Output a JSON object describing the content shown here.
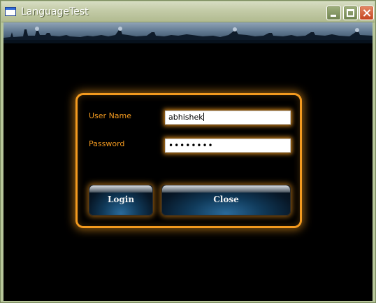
{
  "window": {
    "title": "LanguageTest"
  },
  "titlebar": {
    "minimize_icon": "minimize-icon",
    "maximize_icon": "maximize-icon",
    "close_icon": "close-icon"
  },
  "login": {
    "user_label": "User Name",
    "user_value": "abhishek",
    "password_label": "Password",
    "password_value": "••••••••",
    "login_button": "Login",
    "close_button": "Close"
  },
  "colors": {
    "accent": "#f39a1f",
    "background": "#000000",
    "button": "#0d3454"
  }
}
